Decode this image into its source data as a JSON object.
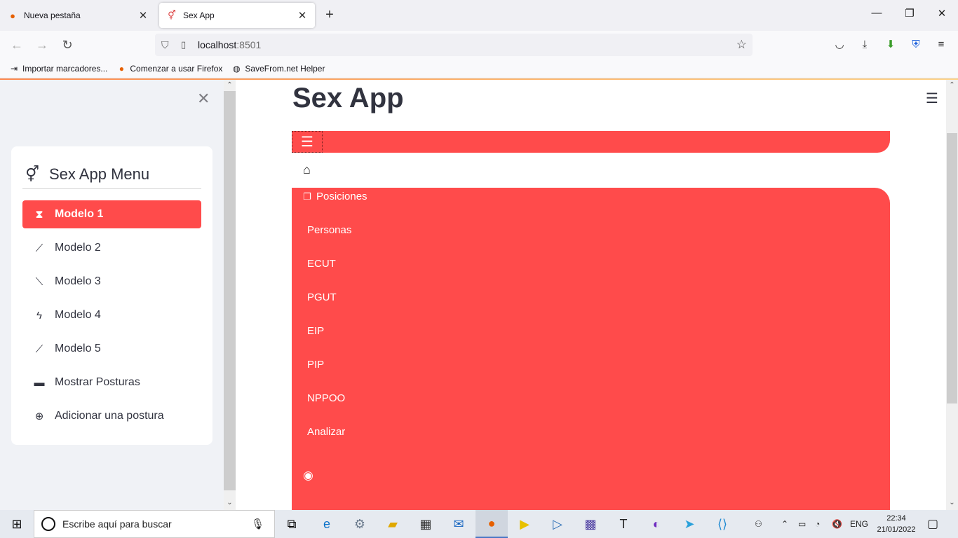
{
  "browser": {
    "tabs": [
      {
        "title": "Nueva pestaña",
        "icon": "firefox-icon"
      },
      {
        "title": "Sex App",
        "icon": "gender-icon"
      }
    ],
    "url_host": "localhost",
    "url_port": ":8501",
    "bookmarks": [
      {
        "label": "Importar marcadores...",
        "icon": "import-icon"
      },
      {
        "label": "Comenzar a usar Firefox",
        "icon": "firefox-icon"
      },
      {
        "label": "SaveFrom.net Helper",
        "icon": "globe-icon"
      }
    ]
  },
  "sidebar": {
    "menu_title": "Sex App Menu",
    "items": [
      {
        "label": "Modelo 1",
        "icon": "hourglass-icon",
        "selected": true
      },
      {
        "label": "Modelo 2",
        "icon": "graph-up-icon"
      },
      {
        "label": "Modelo 3",
        "icon": "graph-down-icon"
      },
      {
        "label": "Modelo 4",
        "icon": "lightning-icon"
      },
      {
        "label": "Modelo 5",
        "icon": "graph-up-icon"
      },
      {
        "label": "Mostrar Posturas",
        "icon": "folder-icon"
      },
      {
        "label": "Adicionar una postura",
        "icon": "plus-circle-icon"
      }
    ]
  },
  "main": {
    "title": "Sex App",
    "nav": {
      "first_item": "Posiciones",
      "items": [
        "Personas",
        "ECUT",
        "PGUT",
        "EIP",
        "PIP",
        "NPPOO",
        "Analizar"
      ]
    }
  },
  "taskbar": {
    "search_placeholder": "Escribe aquí para buscar",
    "language": "ENG",
    "time": "22:34",
    "date": "21/01/2022"
  },
  "colors": {
    "accent": "#ff4b4b",
    "sidebar_bg": "#f0f2f6",
    "text": "#31333f"
  }
}
